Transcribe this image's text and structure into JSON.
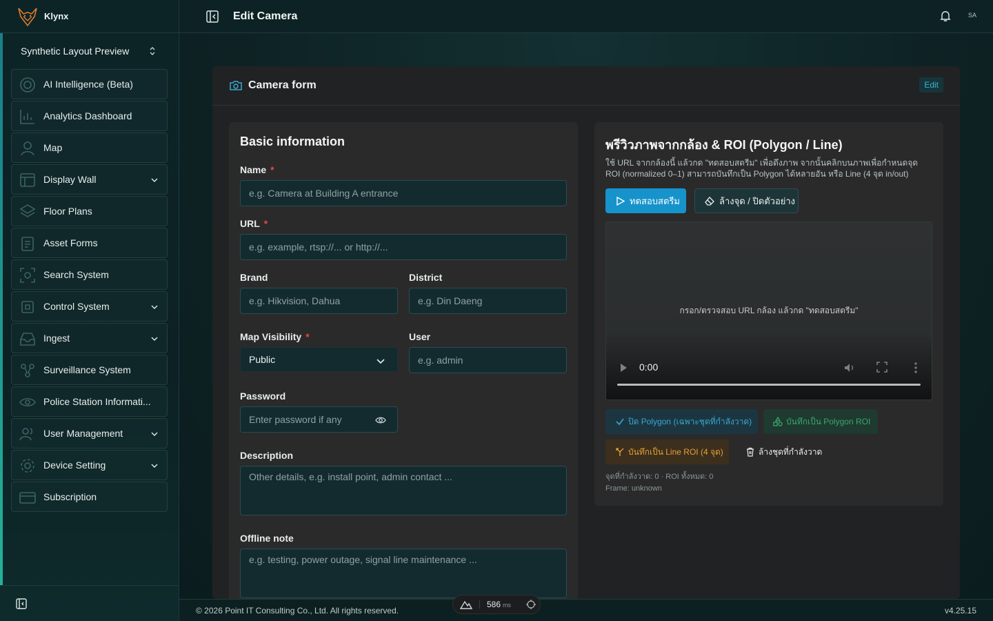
{
  "brand": {
    "name": "Klynx"
  },
  "workspace": {
    "name": "Synthetic Layout Preview"
  },
  "sidebar": {
    "items": [
      {
        "label": "AI Intelligence (Beta)",
        "icon": "ai-icon",
        "has_children": false
      },
      {
        "label": "Analytics Dashboard",
        "icon": "chart-icon",
        "has_children": false
      },
      {
        "label": "Map",
        "icon": "map-icon",
        "has_children": false
      },
      {
        "label": "Display Wall",
        "icon": "display-icon",
        "has_children": true
      },
      {
        "label": "Floor Plans",
        "icon": "layers-icon",
        "has_children": false
      },
      {
        "label": "Asset Forms",
        "icon": "clipboard-icon",
        "has_children": false
      },
      {
        "label": "Search System",
        "icon": "scan-icon",
        "has_children": false
      },
      {
        "label": "Control System",
        "icon": "cpu-icon",
        "has_children": true
      },
      {
        "label": "Ingest",
        "icon": "inbox-icon",
        "has_children": true
      },
      {
        "label": "Surveillance System",
        "icon": "network-icon",
        "has_children": false
      },
      {
        "label": "Police Station Informati...",
        "icon": "eye-icon",
        "has_children": false
      },
      {
        "label": "User Management",
        "icon": "users-icon",
        "has_children": true
      },
      {
        "label": "Device Setting",
        "icon": "gear-icon",
        "has_children": true
      },
      {
        "label": "Subscription",
        "icon": "card-icon",
        "has_children": false
      }
    ]
  },
  "header": {
    "title": "Edit Camera",
    "avatar": "SA"
  },
  "card": {
    "title": "Camera form",
    "badge": "Edit"
  },
  "basic": {
    "title": "Basic information",
    "name": {
      "label": "Name",
      "required": "*",
      "placeholder": "e.g. Camera at Building A entrance"
    },
    "url": {
      "label": "URL",
      "required": "*",
      "placeholder": "e.g. example, rtsp://... or http://..."
    },
    "brand": {
      "label": "Brand",
      "placeholder": "e.g. Hikvision, Dahua"
    },
    "district": {
      "label": "District",
      "placeholder": "e.g. Din Daeng"
    },
    "visibility": {
      "label": "Map Visibility",
      "required": "*",
      "value": "Public"
    },
    "user": {
      "label": "User",
      "placeholder": "e.g. admin"
    },
    "password": {
      "label": "Password",
      "placeholder": "Enter password if any"
    },
    "description": {
      "label": "Description",
      "placeholder": "Other details, e.g. install point, admin contact ..."
    },
    "offline": {
      "label": "Offline note",
      "placeholder": "e.g. testing, power outage, signal line maintenance ..."
    }
  },
  "preview": {
    "title": "พรีวิวภาพจากกล้อง & ROI (Polygon / Line)",
    "description": "ใช้ URL จากกล้องนี้ แล้วกด \"ทดสอบสตรีม\" เพื่อดึงภาพ จากนั้นคลิกบนภาพเพื่อกำหนดจุด ROI (normalized 0–1) สามารถบันทึกเป็น Polygon ได้หลายอัน หรือ Line (4 จุด in/out)",
    "test_button": "ทดสอบสตรีม",
    "clear_button": "ล้างจุด / ปิดตัวอย่าง",
    "video_placeholder": "กรอก/ตรวจสอบ URL กล้อง แล้วกด \"ทดสอบสตรีม\"",
    "video_time": "0:00",
    "close_polygon": "ปิด Polygon (เฉพาะชุดที่กำลังวาด)",
    "save_polygon": "บันทึกเป็น Polygon ROI",
    "save_line": "บันทึกเป็น Line ROI (4 จุด)",
    "clear_current": "ล้างชุดที่กำลังวาด",
    "points_status": "จุดที่กำลังวาด: 0 · ROI ทั้งหมด: 0",
    "frame_status": "Frame: unknown"
  },
  "footer": {
    "copyright": "© 2026 Point IT Consulting Co., Ltd. All rights reserved.",
    "version": "v4.25.15"
  },
  "devtools": {
    "ms": "586",
    "unit": "ms"
  },
  "colors": {
    "accent": "#1793cc",
    "required": "#e24a4a",
    "polygon_green": "#3aa86a",
    "line_orange": "#e2a23a"
  }
}
